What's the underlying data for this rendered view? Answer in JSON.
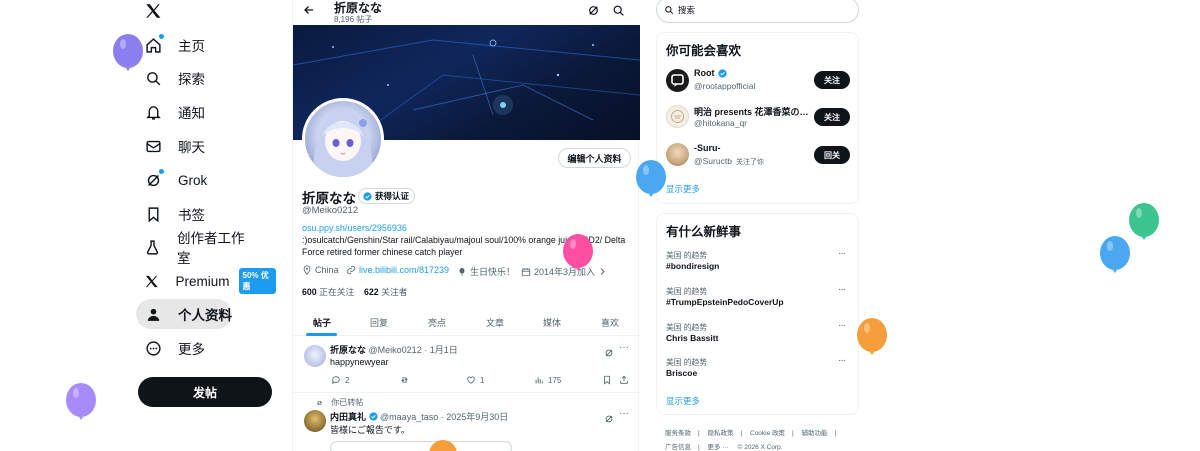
{
  "nav": {
    "items": [
      {
        "label": "主页",
        "icon": "home-icon"
      },
      {
        "label": "探索",
        "icon": "search-icon"
      },
      {
        "label": "通知",
        "icon": "bell-icon"
      },
      {
        "label": "聊天",
        "icon": "mail-icon"
      },
      {
        "label": "Grok",
        "icon": "grok-icon"
      },
      {
        "label": "书签",
        "icon": "bookmark-icon"
      },
      {
        "label": "创作者工作室",
        "icon": "flask-icon"
      },
      {
        "label": "Premium",
        "icon": "x-premium-icon",
        "badge": "50% 优惠"
      },
      {
        "label": "个人资料",
        "icon": "person-icon"
      },
      {
        "label": "更多",
        "icon": "more-circle-icon"
      }
    ],
    "post_label": "发帖"
  },
  "profile": {
    "topbar_name": "折原なな",
    "post_count": "8,196 帖子",
    "edit_label": "编辑个人资料",
    "name": "折原なな",
    "verify_label": "获得认证",
    "handle": "@Meiko0212",
    "bio_link": "osu.ppy.sh/users/2956936",
    "bio": ":)osulcatch/Genshin/Star rail/Calabiyau/majoul soul/100% orange juice/L4D2/ Delta Force   retired former chinese catch player",
    "location": "China",
    "website": "live.bilibili.com/817239",
    "birthday": "生日快乐！",
    "joined": "2014年3月加入",
    "following_count": "600",
    "following_label": "正在关注",
    "followers_count": "622",
    "followers_label": "关注者",
    "tabs": [
      "帖子",
      "回复",
      "亮点",
      "文章",
      "媒体",
      "喜欢"
    ]
  },
  "tweets": [
    {
      "name": "折原なな",
      "meta": "@Meiko0212 · 1月1日",
      "text": "happynewyear",
      "replies": "2",
      "likes": "1",
      "views": "175"
    },
    {
      "retweet_label": "你已转帖",
      "name": "内田真礼",
      "meta": "@maaya_taso · 2025年9月30日",
      "text": "皆様にご報告です。"
    }
  ],
  "search": {
    "placeholder": "搜索"
  },
  "who_to_follow": {
    "title": "你可能会喜欢",
    "accounts": [
      {
        "name": "Root",
        "handle": "@rootappofficial",
        "button": "关注"
      },
      {
        "name": "明治 presents 花澤香菜の…",
        "handle": "@hitokana_qr",
        "button": "关注"
      },
      {
        "name": "-Suru-",
        "handle": "@Suructb",
        "note": "关注了你",
        "button": "回关"
      }
    ],
    "show_more": "显示更多"
  },
  "trends": {
    "title": "有什么新鲜事",
    "items": [
      {
        "meta": "美国 的趋势",
        "name": "#bondiresign"
      },
      {
        "meta": "美国 的趋势",
        "name": "#TrumpEpsteinPedoCoverUp"
      },
      {
        "meta": "美国 的趋势",
        "name": "Chris Bassitt"
      },
      {
        "meta": "美国 的趋势",
        "name": "Briscoe"
      }
    ],
    "show_more": "显示更多"
  },
  "footer": {
    "links": [
      "服务条款",
      "隐私政策",
      "Cookie 政策",
      "辅助功能",
      "广告信息",
      "更多 ···",
      "© 2026 X Corp."
    ]
  },
  "colors": {
    "accent": "#1d9bf0",
    "balloons": [
      "#8b7ff0",
      "#a78bfa",
      "#ff4fa3",
      "#4aa8f0",
      "#f59e3b",
      "#3cc48f",
      "#4aa8f0"
    ]
  }
}
